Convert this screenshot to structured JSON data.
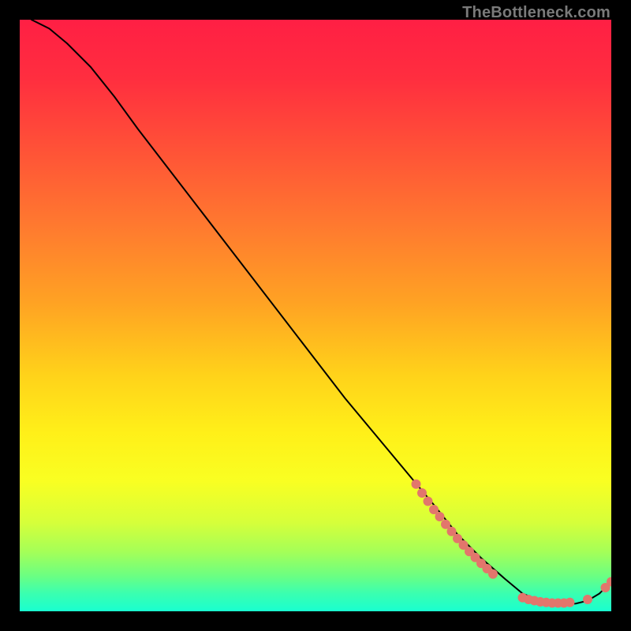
{
  "watermark": "TheBottleneck.com",
  "chart_data": {
    "type": "line",
    "title": "",
    "xlabel": "",
    "ylabel": "",
    "xlim": [
      0,
      100
    ],
    "ylim": [
      0,
      100
    ],
    "grid": false,
    "legend": false,
    "series": [
      {
        "name": "curve",
        "style": "line",
        "color": "#000000",
        "x": [
          2,
          5,
          8,
          12,
          16,
          20,
          25,
          30,
          35,
          40,
          45,
          50,
          55,
          60,
          65,
          70,
          74,
          78,
          82,
          85,
          88,
          90,
          92,
          94,
          96,
          98,
          100
        ],
        "y": [
          100,
          98.5,
          96,
          92,
          87,
          81.5,
          75,
          68.5,
          62,
          55.5,
          49,
          42.5,
          36,
          30,
          24,
          18,
          13,
          9,
          5.5,
          3,
          1.8,
          1.3,
          1.2,
          1.3,
          1.8,
          3,
          5
        ]
      },
      {
        "name": "markers-upper",
        "style": "scatter",
        "color": "#e2766c",
        "x": [
          67,
          68,
          69,
          70,
          71,
          72,
          73,
          74,
          75,
          76,
          77,
          78,
          79,
          80
        ],
        "y": [
          21.5,
          20,
          18.6,
          17.2,
          16,
          14.7,
          13.5,
          12.3,
          11.2,
          10.1,
          9.1,
          8.1,
          7.2,
          6.3
        ]
      },
      {
        "name": "markers-valley",
        "style": "scatter",
        "color": "#e2766c",
        "x": [
          85,
          86,
          87,
          88,
          89,
          90,
          91,
          92,
          93,
          96
        ],
        "y": [
          2.3,
          2.0,
          1.8,
          1.6,
          1.5,
          1.4,
          1.4,
          1.4,
          1.5,
          2.0
        ]
      },
      {
        "name": "markers-tail",
        "style": "scatter",
        "color": "#e2766c",
        "x": [
          99,
          100
        ],
        "y": [
          4.0,
          5.0
        ]
      }
    ],
    "gradient_stops": [
      {
        "offset": 0.0,
        "color": "#ff1f44"
      },
      {
        "offset": 0.1,
        "color": "#ff2e3f"
      },
      {
        "offset": 0.22,
        "color": "#ff5237"
      },
      {
        "offset": 0.35,
        "color": "#ff7a2f"
      },
      {
        "offset": 0.48,
        "color": "#ffa323"
      },
      {
        "offset": 0.6,
        "color": "#ffd21a"
      },
      {
        "offset": 0.7,
        "color": "#fff019"
      },
      {
        "offset": 0.78,
        "color": "#f9ff22"
      },
      {
        "offset": 0.85,
        "color": "#d6ff3a"
      },
      {
        "offset": 0.9,
        "color": "#a4ff58"
      },
      {
        "offset": 0.94,
        "color": "#6bff82"
      },
      {
        "offset": 0.97,
        "color": "#3affb0"
      },
      {
        "offset": 1.0,
        "color": "#19ffd0"
      }
    ]
  }
}
